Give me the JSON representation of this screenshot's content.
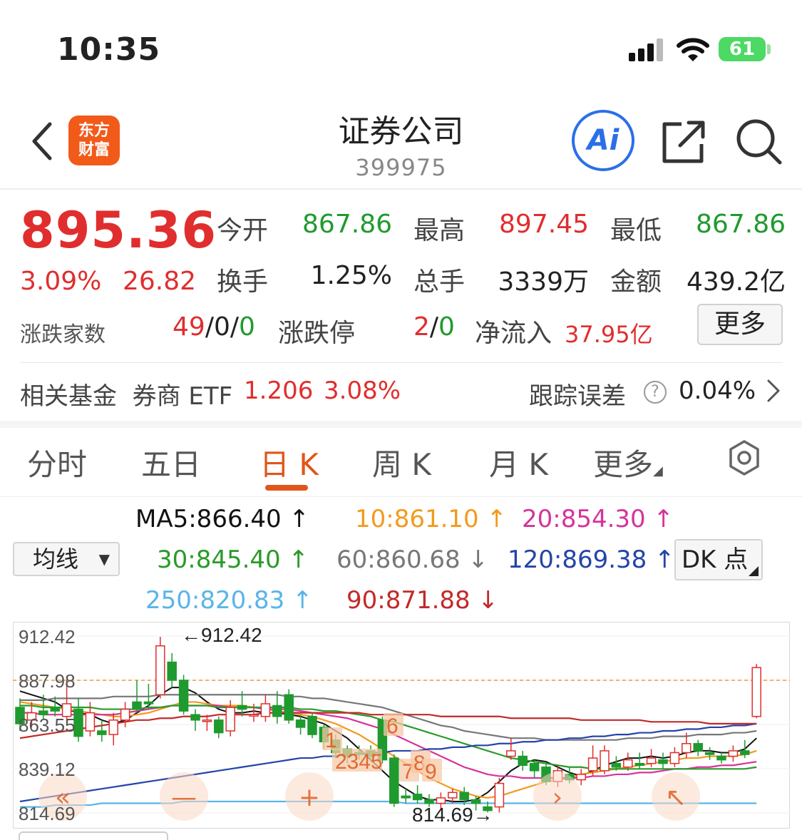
{
  "status_bar": {
    "time": "10:35",
    "battery": "61"
  },
  "header": {
    "title": "证券公司",
    "code": "399975",
    "logo_line1": "东方",
    "logo_line2": "财富",
    "ai_label": "Ai"
  },
  "quote": {
    "price": "895.36",
    "change_pct": "3.09%",
    "change": "26.82",
    "open_label": "今开",
    "open": "867.86",
    "high_label": "最高",
    "high": "897.45",
    "low_label": "最低",
    "low": "867.86",
    "turnover_label": "换手",
    "turnover": "1.25%",
    "volume_label": "总手",
    "volume": "3339万",
    "amount_label": "金额",
    "amount": "439.2亿",
    "breadth_label": "涨跌家数",
    "breadth_up": "49",
    "breadth_flat": "0",
    "breadth_down": "0",
    "limit_label": "涨跌停",
    "limit_up": "2",
    "limit_down": "0",
    "inflow_label": "净流入",
    "inflow": "37.95亿",
    "more_label": "更多"
  },
  "fund": {
    "label": "相关基金",
    "name": "券商 ETF",
    "value": "1.206",
    "pct": "3.08%",
    "tracking_label": "跟踪误差",
    "tracking_value": "0.04%"
  },
  "tabs": [
    {
      "label": "分时"
    },
    {
      "label": "五日"
    },
    {
      "label": "日 K"
    },
    {
      "label": "周 K"
    },
    {
      "label": "月 K"
    },
    {
      "label": "更多"
    }
  ],
  "active_tab": "日 K",
  "ma_legend": {
    "selector": "均线",
    "dk_label": "DK 点",
    "items": [
      {
        "text": "MA5:866.40 ↑",
        "color": "#111111"
      },
      {
        "text": "10:861.10 ↑",
        "color": "#f39a1e"
      },
      {
        "text": "20:854.30 ↑",
        "color": "#d6339a"
      },
      {
        "text": "30:845.40 ↑",
        "color": "#2a9a2a"
      },
      {
        "text": "60:860.68 ↓",
        "color": "#777777"
      },
      {
        "text": "120:869.38 ↑",
        "color": "#2444a8"
      },
      {
        "text": "250:820.83 ↑",
        "color": "#5ab4e8"
      },
      {
        "text": "90:871.88 ↓",
        "color": "#c22a2a"
      }
    ]
  },
  "chart_data": {
    "type": "candlestick",
    "y_ticks": [
      "912.42",
      "887.98",
      "863.55",
      "839.12",
      "814.69"
    ],
    "reference_line": 887.98,
    "ylim": [
      814.69,
      912.42
    ],
    "high_label": "912.42",
    "low_label": "814.69",
    "candles": [
      {
        "o": 873,
        "c": 864,
        "h": 878,
        "l": 860
      },
      {
        "o": 866,
        "c": 870,
        "h": 876,
        "l": 862
      },
      {
        "o": 871,
        "c": 869,
        "h": 880,
        "l": 866
      },
      {
        "o": 873,
        "c": 871,
        "h": 879,
        "l": 868
      },
      {
        "o": 868,
        "c": 875,
        "h": 888,
        "l": 865
      },
      {
        "o": 872,
        "c": 857,
        "h": 878,
        "l": 854
      },
      {
        "o": 860,
        "c": 870,
        "h": 876,
        "l": 857
      },
      {
        "o": 860,
        "c": 858,
        "h": 866,
        "l": 854
      },
      {
        "o": 858,
        "c": 866,
        "h": 870,
        "l": 852
      },
      {
        "o": 866,
        "c": 872,
        "h": 876,
        "l": 862
      },
      {
        "o": 876,
        "c": 872,
        "h": 888,
        "l": 870
      },
      {
        "o": 876,
        "c": 875,
        "h": 886,
        "l": 872
      },
      {
        "o": 880,
        "c": 907,
        "h": 912,
        "l": 878
      },
      {
        "o": 898,
        "c": 888,
        "h": 903,
        "l": 884
      },
      {
        "o": 888,
        "c": 871,
        "h": 891,
        "l": 869
      },
      {
        "o": 869,
        "c": 866,
        "h": 872,
        "l": 860
      },
      {
        "o": 866,
        "c": 866,
        "h": 869,
        "l": 860
      },
      {
        "o": 866,
        "c": 859,
        "h": 868,
        "l": 856
      },
      {
        "o": 860,
        "c": 873,
        "h": 877,
        "l": 857
      },
      {
        "o": 874,
        "c": 872,
        "h": 882,
        "l": 868
      },
      {
        "o": 869,
        "c": 869,
        "h": 875,
        "l": 865
      },
      {
        "o": 868,
        "c": 875,
        "h": 880,
        "l": 865
      },
      {
        "o": 874,
        "c": 868,
        "h": 882,
        "l": 864
      },
      {
        "o": 880,
        "c": 866,
        "h": 883,
        "l": 864
      },
      {
        "o": 866,
        "c": 862,
        "h": 869,
        "l": 858
      },
      {
        "o": 868,
        "c": 858,
        "h": 870,
        "l": 856
      },
      {
        "o": 862,
        "c": 854,
        "h": 864,
        "l": 850
      },
      {
        "o": 855,
        "c": 848,
        "h": 858,
        "l": 845
      },
      {
        "o": 850,
        "c": 846,
        "h": 852,
        "l": 842
      },
      {
        "o": 848,
        "c": 847,
        "h": 852,
        "l": 844
      },
      {
        "o": 849,
        "c": 846,
        "h": 852,
        "l": 843
      },
      {
        "o": 866,
        "c": 844,
        "h": 868,
        "l": 842
      },
      {
        "o": 845,
        "c": 820,
        "h": 847,
        "l": 818
      },
      {
        "o": 824,
        "c": 823,
        "h": 828,
        "l": 820
      },
      {
        "o": 825,
        "c": 822,
        "h": 830,
        "l": 820
      },
      {
        "o": 822,
        "c": 820,
        "h": 825,
        "l": 818
      },
      {
        "o": 820,
        "c": 823,
        "h": 826,
        "l": 817
      },
      {
        "o": 823,
        "c": 826,
        "h": 828,
        "l": 820
      },
      {
        "o": 826,
        "c": 822,
        "h": 829,
        "l": 819
      },
      {
        "o": 822,
        "c": 820,
        "h": 824,
        "l": 816
      },
      {
        "o": 818,
        "c": 816,
        "h": 821,
        "l": 815
      },
      {
        "o": 818,
        "c": 831,
        "h": 834,
        "l": 815
      },
      {
        "o": 846,
        "c": 849,
        "h": 856,
        "l": 844
      },
      {
        "o": 846,
        "c": 841,
        "h": 849,
        "l": 838
      },
      {
        "o": 842,
        "c": 838,
        "h": 844,
        "l": 834
      },
      {
        "o": 840,
        "c": 832,
        "h": 842,
        "l": 830
      },
      {
        "o": 832,
        "c": 838,
        "h": 841,
        "l": 829
      },
      {
        "o": 836,
        "c": 833,
        "h": 840,
        "l": 831
      },
      {
        "o": 833,
        "c": 836,
        "h": 839,
        "l": 830
      },
      {
        "o": 838,
        "c": 845,
        "h": 852,
        "l": 835
      },
      {
        "o": 838,
        "c": 849,
        "h": 852,
        "l": 836
      },
      {
        "o": 842,
        "c": 840,
        "h": 846,
        "l": 838
      },
      {
        "o": 840,
        "c": 844,
        "h": 848,
        "l": 838
      },
      {
        "o": 842,
        "c": 841,
        "h": 848,
        "l": 839
      },
      {
        "o": 842,
        "c": 845,
        "h": 850,
        "l": 840
      },
      {
        "o": 844,
        "c": 842,
        "h": 848,
        "l": 839
      },
      {
        "o": 842,
        "c": 848,
        "h": 851,
        "l": 840
      },
      {
        "o": 848,
        "c": 853,
        "h": 859,
        "l": 845
      },
      {
        "o": 853,
        "c": 849,
        "h": 855,
        "l": 846
      },
      {
        "o": 848,
        "c": 847,
        "h": 851,
        "l": 844
      },
      {
        "o": 846,
        "c": 844,
        "h": 848,
        "l": 842
      },
      {
        "o": 846,
        "c": 849,
        "h": 852,
        "l": 843
      },
      {
        "o": 849,
        "c": 847,
        "h": 855,
        "l": 845
      },
      {
        "o": 868,
        "c": 895,
        "h": 897,
        "l": 867
      }
    ],
    "ma_lines": [
      {
        "name": "MA5",
        "color": "#111111",
        "values": [
          882,
          880,
          878,
          876,
          872,
          870,
          869,
          866,
          864,
          866,
          870,
          874,
          880,
          884,
          884,
          881,
          876,
          872,
          870,
          870,
          871,
          870,
          870,
          869,
          868,
          866,
          864,
          860,
          856,
          850,
          844,
          838,
          832,
          828,
          824,
          822,
          822,
          821,
          821,
          822,
          826,
          832,
          838,
          842,
          844,
          843,
          840,
          837,
          835,
          838,
          841,
          843,
          845,
          845,
          846,
          845,
          846,
          848,
          849,
          849,
          848,
          848,
          850,
          856
        ]
      },
      {
        "name": "10",
        "color": "#f39a1e",
        "values": [
          876,
          875,
          874,
          873,
          872,
          871,
          870,
          869,
          868,
          868,
          869,
          870,
          872,
          874,
          876,
          876,
          875,
          874,
          874,
          874,
          873,
          872,
          871,
          870,
          869,
          868,
          866,
          864,
          861,
          858,
          854,
          850,
          846,
          842,
          838,
          834,
          831,
          828,
          826,
          824,
          823,
          824,
          826,
          828,
          830,
          832,
          833,
          834,
          836,
          837,
          838,
          839,
          840,
          841,
          842,
          843,
          844,
          845,
          845,
          846,
          846,
          846,
          847,
          849
        ]
      },
      {
        "name": "20",
        "color": "#d6339a",
        "values": [
          870,
          870,
          869,
          869,
          869,
          869,
          869,
          869,
          869,
          870,
          871,
          872,
          873,
          874,
          874,
          874,
          874,
          874,
          873,
          873,
          873,
          872,
          872,
          872,
          871,
          870,
          869,
          868,
          867,
          865,
          863,
          861,
          858,
          855,
          852,
          849,
          846,
          843,
          840,
          838,
          836,
          835,
          835,
          834,
          834,
          834,
          834,
          834,
          834,
          835,
          835,
          836,
          836,
          837,
          837,
          838,
          839,
          839,
          840,
          840,
          841,
          841,
          842,
          843
        ]
      },
      {
        "name": "30",
        "color": "#2a9a2a",
        "values": [
          874,
          874,
          873,
          873,
          873,
          873,
          873,
          872,
          872,
          872,
          872,
          873,
          873,
          874,
          874,
          874,
          874,
          873,
          873,
          873,
          873,
          873,
          873,
          873,
          872,
          872,
          871,
          871,
          870,
          869,
          868,
          866,
          865,
          863,
          861,
          859,
          857,
          855,
          853,
          851,
          849,
          847,
          845,
          844,
          843,
          842,
          841,
          840,
          840,
          839,
          839,
          839,
          839,
          839,
          839,
          839,
          839,
          839,
          839,
          839,
          839,
          839,
          839,
          840
        ]
      },
      {
        "name": "60",
        "color": "#777777",
        "values": [
          877,
          877,
          877,
          878,
          878,
          878,
          878,
          878,
          879,
          879,
          879,
          879,
          880,
          880,
          880,
          880,
          880,
          880,
          880,
          880,
          880,
          880,
          880,
          879,
          879,
          878,
          878,
          877,
          876,
          875,
          874,
          873,
          871,
          869,
          867,
          865,
          863,
          862,
          860,
          859,
          858,
          857,
          856,
          856,
          856,
          855,
          855,
          855,
          855,
          855,
          855,
          855,
          856,
          856,
          856,
          857,
          857,
          857,
          858,
          858,
          858,
          859,
          859,
          860
        ]
      },
      {
        "name": "120",
        "color": "#2444a8",
        "values": [
          821,
          822,
          823,
          824,
          825,
          826,
          827,
          828,
          829,
          830,
          831,
          832,
          833,
          834,
          835,
          836,
          837,
          838,
          839,
          840,
          841,
          842,
          843,
          844,
          845,
          845,
          846,
          846,
          847,
          847,
          848,
          848,
          849,
          849,
          849,
          850,
          850,
          851,
          851,
          852,
          852,
          853,
          853,
          854,
          854,
          855,
          855,
          856,
          856,
          857,
          857,
          858,
          858,
          859,
          859,
          860,
          860,
          861,
          861,
          862,
          862,
          863,
          863,
          864
        ]
      },
      {
        "name": "250",
        "color": "#5ab4e8",
        "values": [
          818,
          818,
          818,
          819,
          819,
          819,
          819,
          820,
          820,
          820,
          820,
          820,
          820,
          820,
          821,
          821,
          821,
          821,
          821,
          821,
          821,
          821,
          821,
          821,
          821,
          821,
          821,
          821,
          821,
          821,
          821,
          821,
          821,
          820,
          820,
          820,
          820,
          820,
          820,
          820,
          820,
          820,
          820,
          820,
          820,
          820,
          820,
          820,
          820,
          820,
          820,
          820,
          820,
          820,
          820,
          820,
          820,
          820,
          820,
          820,
          820,
          820,
          820,
          820
        ]
      },
      {
        "name": "90",
        "color": "#c22a2a",
        "values": [
          856,
          857,
          858,
          859,
          860,
          861,
          862,
          863,
          864,
          865,
          866,
          866,
          867,
          867,
          868,
          868,
          868,
          869,
          869,
          869,
          869,
          870,
          870,
          870,
          870,
          870,
          870,
          870,
          870,
          870,
          869,
          869,
          869,
          869,
          869,
          869,
          868,
          868,
          868,
          868,
          868,
          868,
          867,
          867,
          867,
          867,
          867,
          867,
          866,
          866,
          866,
          866,
          866,
          866,
          865,
          865,
          865,
          865,
          865,
          864,
          864,
          864,
          864,
          864
        ]
      }
    ],
    "signal_labels": [
      "1",
      "2345",
      "6",
      "7",
      "8",
      "9"
    ]
  }
}
